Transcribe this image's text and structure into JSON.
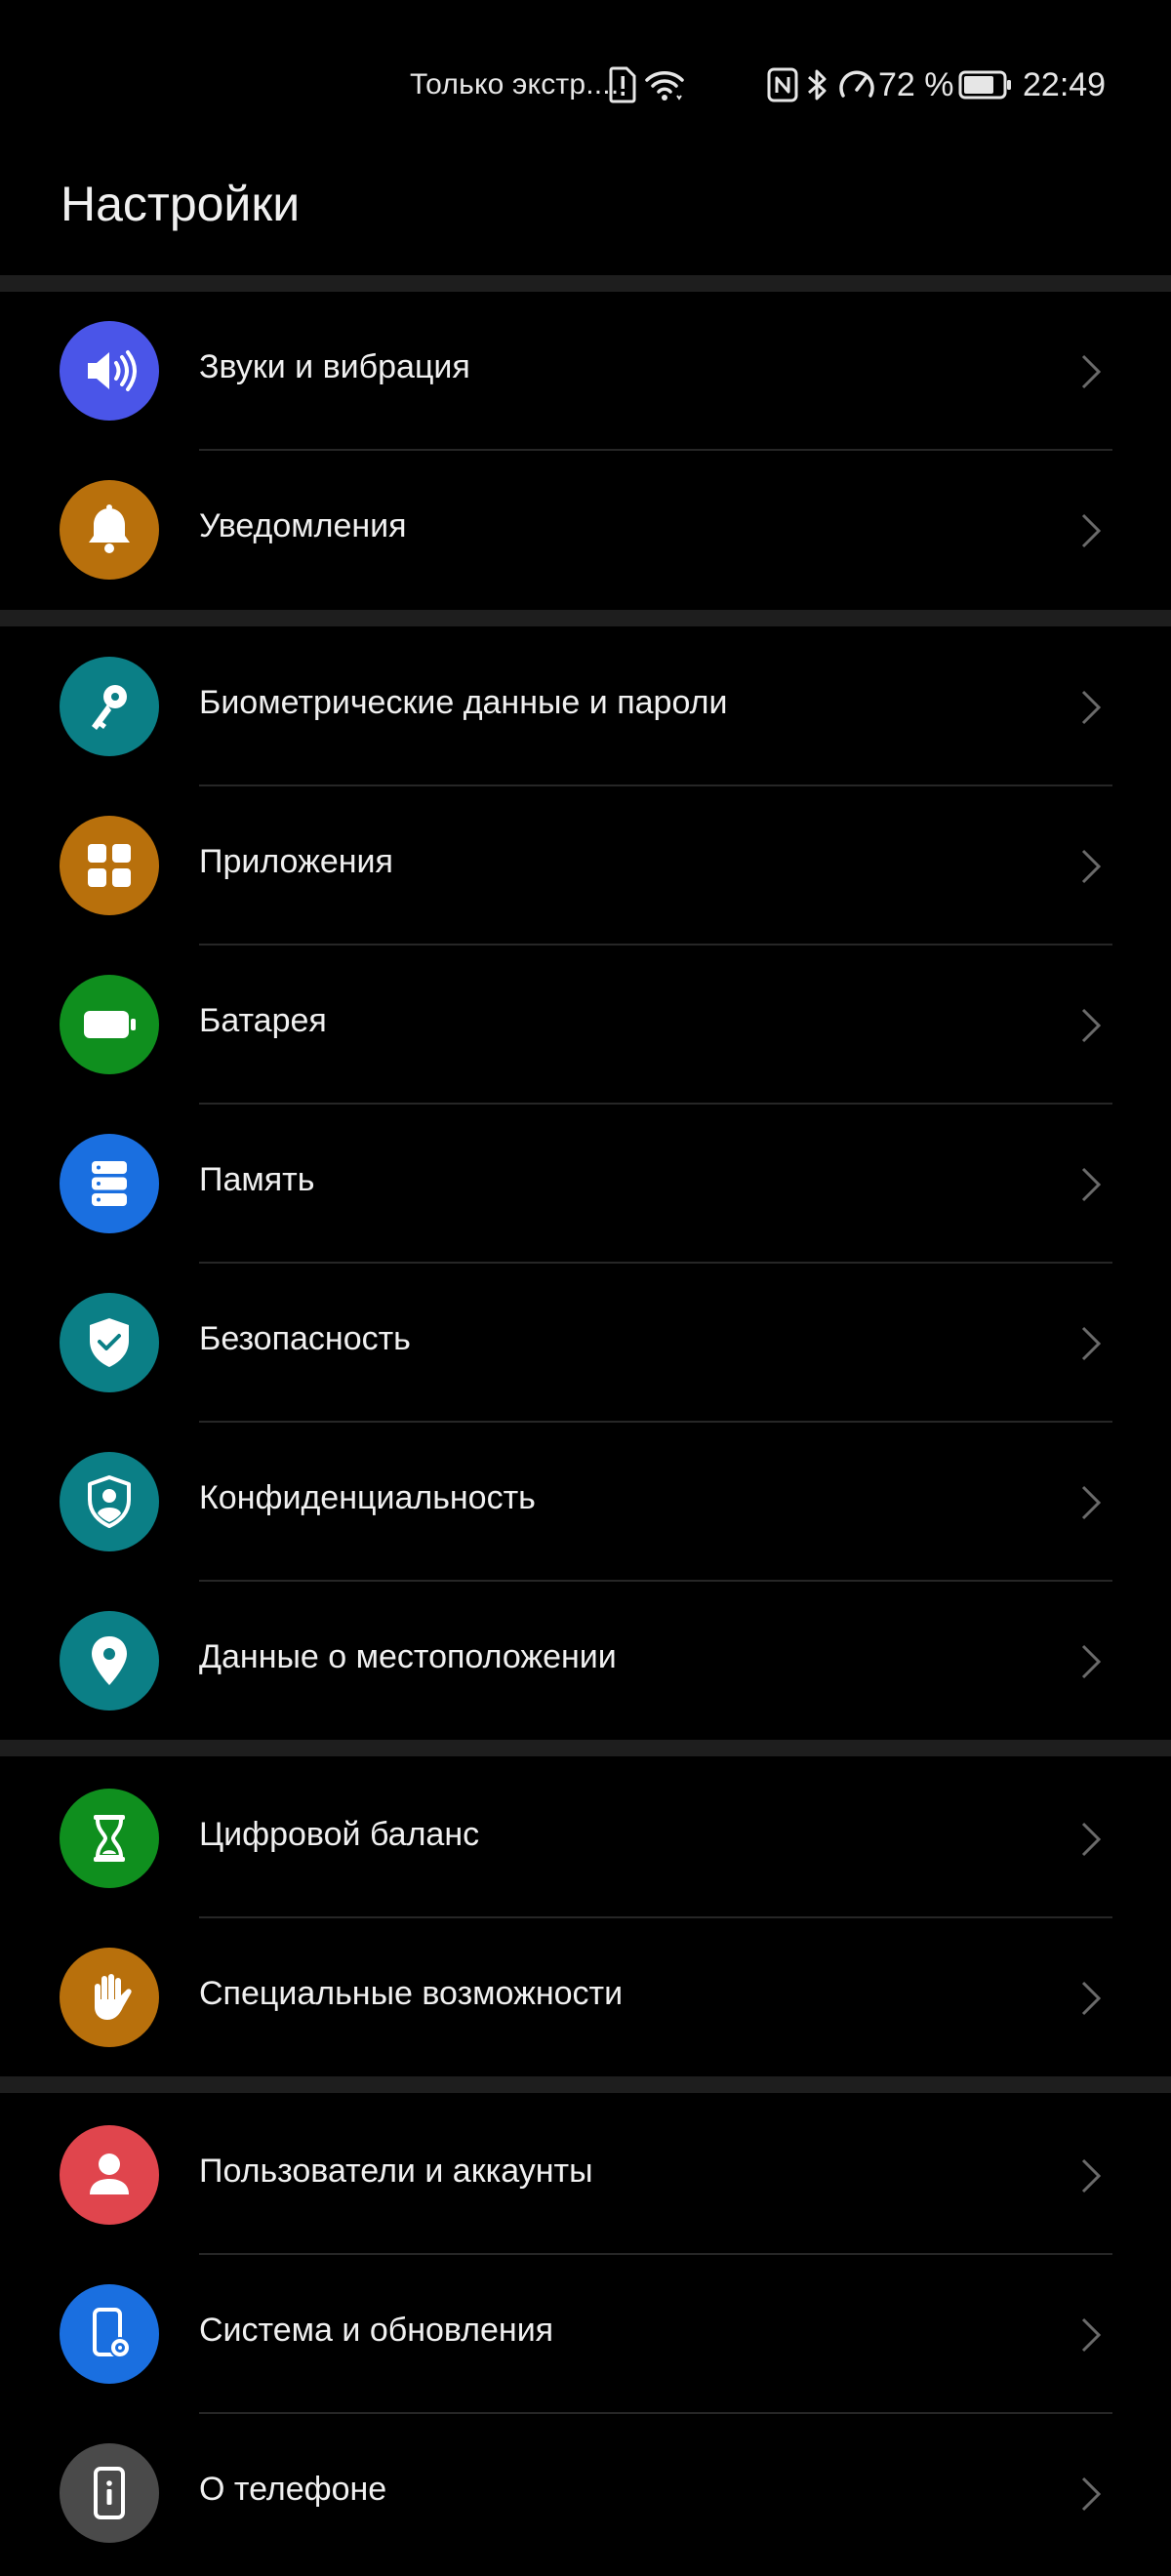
{
  "status_bar": {
    "carrier": "Только экстр....",
    "battery_percent": "72 %",
    "time": "22:49"
  },
  "page": {
    "title": "Настройки"
  },
  "colors": {
    "background": "#000000",
    "section_divider": "#1e1e1e",
    "sounds": "#4a55e8",
    "notifications": "#b8700c",
    "biometrics": "#0b7f86",
    "apps": "#b8700c",
    "battery": "#0f8f1e",
    "storage": "#1a6fe0",
    "security": "#0b7f86",
    "privacy": "#0b7f86",
    "location": "#0b7f86",
    "digital_balance": "#0f8f1e",
    "accessibility": "#b8700c",
    "users": "#e0454d",
    "system": "#1a6fe0",
    "about": "#4a4a4a"
  },
  "settings": {
    "items": [
      {
        "id": "sounds",
        "label": "Звуки и вибрация",
        "icon": "speaker-icon"
      },
      {
        "id": "notifications",
        "label": "Уведомления",
        "icon": "bell-icon"
      },
      {
        "id": "biometrics",
        "label": "Биометрические данные и пароли",
        "icon": "key-icon"
      },
      {
        "id": "apps",
        "label": "Приложения",
        "icon": "apps-grid-icon"
      },
      {
        "id": "battery",
        "label": "Батарея",
        "icon": "battery-icon"
      },
      {
        "id": "storage",
        "label": "Память",
        "icon": "storage-icon"
      },
      {
        "id": "security",
        "label": "Безопасность",
        "icon": "shield-check-icon"
      },
      {
        "id": "privacy",
        "label": "Конфиденциальность",
        "icon": "shield-user-icon"
      },
      {
        "id": "location",
        "label": "Данные о местоположении",
        "icon": "location-pin-icon"
      },
      {
        "id": "digital_balance",
        "label": "Цифровой баланс",
        "icon": "hourglass-icon"
      },
      {
        "id": "accessibility",
        "label": "Специальные возможности",
        "icon": "hand-icon"
      },
      {
        "id": "users",
        "label": "Пользователи и аккаунты",
        "icon": "user-icon"
      },
      {
        "id": "system",
        "label": "Система и обновления",
        "icon": "phone-gear-icon"
      },
      {
        "id": "about",
        "label": "О телефоне",
        "icon": "phone-info-icon"
      }
    ]
  }
}
